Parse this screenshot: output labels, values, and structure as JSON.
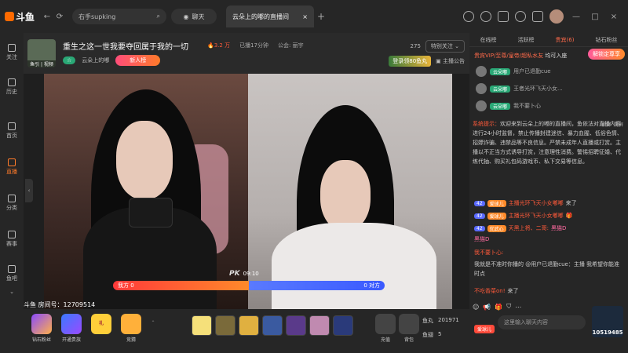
{
  "topbar": {
    "logo": "斗鱼",
    "search_value": "右手supking",
    "chat_label": "聊天",
    "active_tab_title": "云朵上的嘟的直播间",
    "tab_close": "×",
    "tab_add": "+"
  },
  "sidebar": {
    "items": [
      {
        "label": "关注"
      },
      {
        "label": "历史"
      },
      {
        "label": "首页"
      },
      {
        "label": "直播"
      },
      {
        "label": "分类"
      },
      {
        "label": "赛事"
      },
      {
        "label": "鱼吧"
      }
    ]
  },
  "room": {
    "avatar_label": "鱼引 | 视频",
    "title": "重生之这一世我要夺回属于我的一切",
    "hot": "3.2 万",
    "duration": "已播17分钟",
    "guild": "公会: 丽宇",
    "followers": "275",
    "follow_label": "特别关注",
    "level_badge": "☆",
    "anchor_name": "云朵上的嘟",
    "newstar_label": "新人榜",
    "signin_label": "登录领80鱼丸",
    "announcement_label": "主播公告",
    "room_id_label": "斗鱼 房间号：12709514"
  },
  "pk": {
    "logo": "PK",
    "timer": "09:10",
    "left_label": "我方 0",
    "right_label": "0 对方",
    "left_share": 0.5
  },
  "giftbar": {
    "items": [
      {
        "label": "钻石粉丝"
      },
      {
        "label": "开通贵族"
      },
      {
        "label": "礼"
      },
      {
        "label": "竞猜"
      }
    ],
    "recharge_label": "充值",
    "backpack_label": "背包",
    "fishball_label": "鱼丸",
    "fishball_value": "201971",
    "fishchip_label": "鱼翅",
    "fishchip_value": "5"
  },
  "rpanel": {
    "tabs": [
      "在线榜",
      "活跃榜",
      "贵宾(6)",
      "钻石粉丝"
    ],
    "active_tab_index": 2,
    "rank_hint_1": "贵宾VIP/至尊/皇帝/超私水友",
    "rank_hint_2": "均可入座",
    "unlock_label": "解锁定尊享",
    "rank_rows": [
      {
        "tag": "云朵嘟",
        "name": "用户已退勤cue"
      },
      {
        "tag": "云朵嘟",
        "name": "王者光环飞天小女..."
      },
      {
        "tag": "云朵嘟",
        "name": "我不要卜心"
      }
    ],
    "tools": [
      "锁屏",
      "清屏"
    ],
    "system_prefix": "系统提示：",
    "system_msg": "欢迎来到云朵上的嘟的直播间，鱼依法对直播内容进行24小时监督，禁止传播封建迷信、暴力血腥、低俗色情、招嫖诈骗、违禁品等不良信息。严禁未成年人直播或打赏。主播以不正当方式诱导打赏，注意理性消费。警惕招聘征婚、代练代抽、购买礼包码游戏币、私下交易等信息。",
    "messages": [
      {
        "badge": "42",
        "badge2": "爱球儿",
        "name": "主播光环飞天小女嘟嘟",
        "text": "来了"
      },
      {
        "badge": "42",
        "badge2": "爱球儿",
        "name": "主播光环飞天小女嘟嘟",
        "text": ""
      },
      {
        "badge": "42",
        "badge2": "优武心",
        "name": "天黑上将、二哥: ",
        "text": "黑猫D"
      },
      {
        "badge": "",
        "badge2": "",
        "name": "黑猫D",
        "text": ""
      },
      {
        "badge": "",
        "badge2": "",
        "name": "我不要卜心: ",
        "text": "我就是不准时你播的 @用户已退勤cue：主播 我希望你能准时点"
      },
      {
        "badge": "",
        "badge2": "",
        "name": "不吃香菜on!",
        "text": "来了"
      }
    ],
    "input_placeholder": "这里输入聊天内容",
    "gift_user": "爱球儿",
    "send_number": "10519485"
  }
}
